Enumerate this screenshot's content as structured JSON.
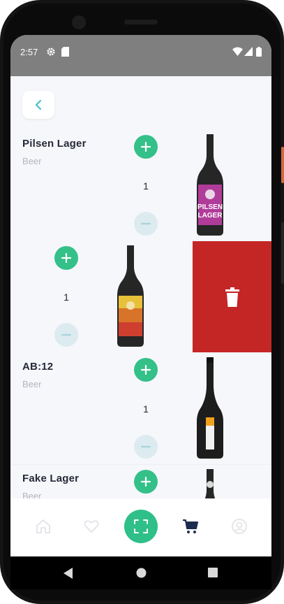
{
  "status_bar": {
    "time": "2:57"
  },
  "nav": {
    "back": "back"
  },
  "items": [
    {
      "name": "Pilsen Lager",
      "category": "Beer",
      "quantity": "1",
      "label_color": "#b03c9a"
    },
    {
      "name": "",
      "category": "",
      "quantity": "1",
      "label_color": "#d8742a"
    },
    {
      "name": "AB:12",
      "category": "Beer",
      "quantity": "1",
      "label_color": "#f0a21e"
    },
    {
      "name": "Fake Lager",
      "category": "Beer",
      "quantity": "",
      "label_color": "#888888"
    }
  ],
  "bottom_nav": [
    "home-icon",
    "heart-icon",
    "scan-icon",
    "cart-icon",
    "profile-icon"
  ],
  "colors": {
    "accent": "#34c089",
    "delete": "#c42626",
    "active_nav": "#1d2b4f"
  }
}
